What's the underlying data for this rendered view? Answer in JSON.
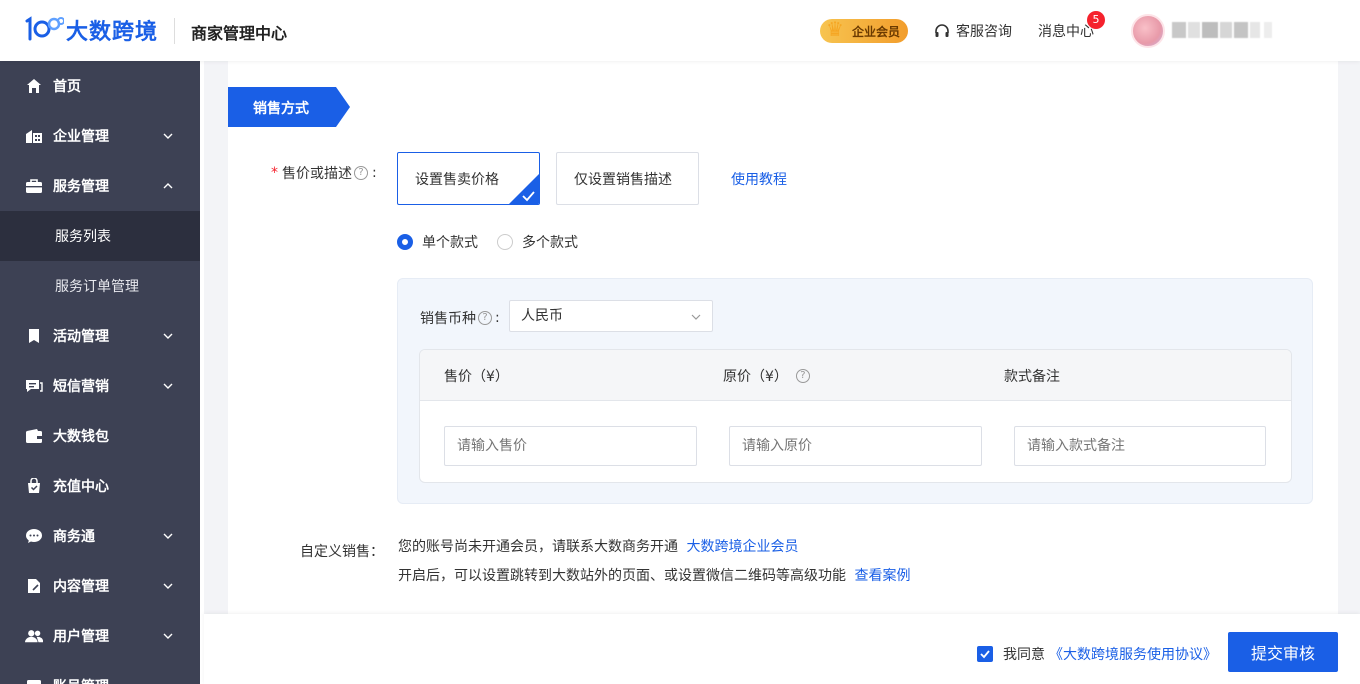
{
  "header": {
    "logo_text": "大数跨境",
    "system_title": "商家管理中心",
    "vip_label": "企业会员",
    "service_label": "客服咨询",
    "messages_label": "消息中心",
    "messages_count": "5"
  },
  "sidebar": {
    "items": [
      {
        "label": "首页",
        "icon": "home-icon"
      },
      {
        "label": "企业管理",
        "icon": "building-icon",
        "expandable": true
      },
      {
        "label": "服务管理",
        "icon": "briefcase-icon",
        "expandable": true,
        "expanded": true
      },
      {
        "label": "活动管理",
        "icon": "bookmark-icon",
        "expandable": true
      },
      {
        "label": "短信营销",
        "icon": "chat-icon",
        "expandable": true
      },
      {
        "label": "大数钱包",
        "icon": "wallet-icon"
      },
      {
        "label": "充值中心",
        "icon": "bag-icon"
      },
      {
        "label": "商务通",
        "icon": "message-icon",
        "expandable": true
      },
      {
        "label": "内容管理",
        "icon": "document-icon",
        "expandable": true
      },
      {
        "label": "用户管理",
        "icon": "users-icon",
        "expandable": true
      },
      {
        "label": "账号管理",
        "icon": "account-icon"
      }
    ],
    "sub_items": [
      {
        "label": "服务列表",
        "active": true
      },
      {
        "label": "服务订单管理",
        "active": false
      }
    ]
  },
  "form": {
    "section_title": "销售方式",
    "price_or_desc_label": "售价或描述",
    "colon": ":",
    "option_price": "设置售卖价格",
    "option_desc": "仅设置销售描述",
    "tutorial_link": "使用教程",
    "radio_single": "单个款式",
    "radio_multi": "多个款式",
    "currency_label": "销售币种",
    "currency_value": "人民币",
    "table": {
      "col_price": "售价（¥）",
      "col_original": "原价（¥）",
      "col_note": "款式备注",
      "ph_price": "请输入售价",
      "ph_original": "请输入原价",
      "ph_note": "请输入款式备注"
    },
    "custom_label": "自定义销售：",
    "custom_line1": "您的账号尚未开通会员，请联系大数商务开通",
    "custom_link1": "大数跨境企业会员",
    "custom_line2": "开启后，可以设置跳转到大数站外的页面、或设置微信二维码等高级功能",
    "custom_link2": "查看案例"
  },
  "footer": {
    "agree_text": "我同意",
    "agreement_link": "《大数跨境服务使用协议》",
    "submit_label": "提交审核"
  },
  "colors": {
    "primary": "#1a5fe6",
    "sidebar_bg": "#3d4154",
    "sidebar_active": "#2c2f3e",
    "badge": "#f5222d"
  }
}
